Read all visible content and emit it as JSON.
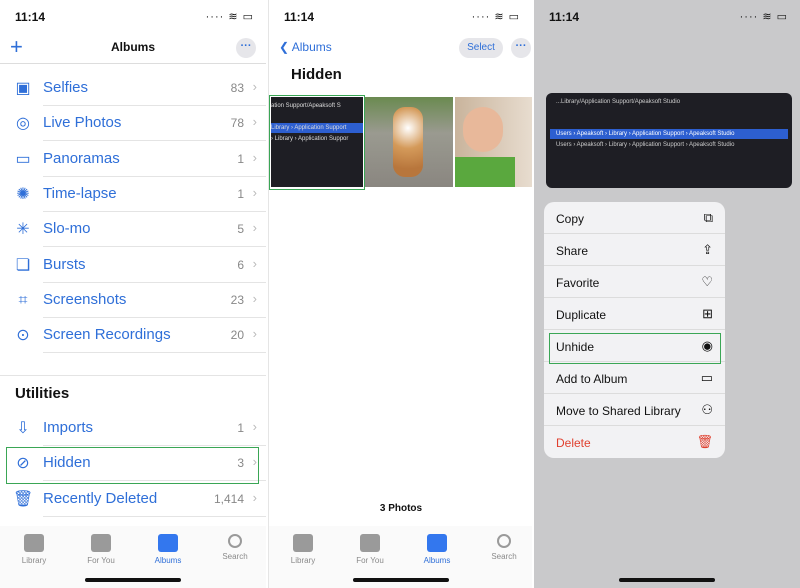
{
  "status": {
    "time": "11:14"
  },
  "albums": {
    "title": "Albums",
    "add_icon": "plus-icon",
    "media_types": [
      {
        "label": "Selfies",
        "count": "83",
        "icon": "person-square-icon"
      },
      {
        "label": "Live Photos",
        "count": "78",
        "icon": "live-photo-icon"
      },
      {
        "label": "Panoramas",
        "count": "1",
        "icon": "panorama-icon"
      },
      {
        "label": "Time-lapse",
        "count": "1",
        "icon": "timelapse-icon"
      },
      {
        "label": "Slo-mo",
        "count": "5",
        "icon": "slomo-icon"
      },
      {
        "label": "Bursts",
        "count": "6",
        "icon": "bursts-icon"
      },
      {
        "label": "Screenshots",
        "count": "23",
        "icon": "camera-viewfinder-icon"
      },
      {
        "label": "Screen Recordings",
        "count": "20",
        "icon": "record-icon"
      }
    ],
    "utilities_header": "Utilities",
    "utilities": [
      {
        "label": "Imports",
        "count": "1",
        "icon": "import-icon"
      },
      {
        "label": "Hidden",
        "count": "3",
        "icon": "eye-slash-icon"
      },
      {
        "label": "Recently Deleted",
        "count": "1,414",
        "icon": "trash-icon"
      }
    ]
  },
  "tabs": [
    {
      "label": "Library"
    },
    {
      "label": "For You"
    },
    {
      "label": "Albums",
      "active": true
    },
    {
      "label": "Search"
    }
  ],
  "hidden": {
    "back_label": "Albums",
    "select_label": "Select",
    "title": "Hidden",
    "photo_count": "3 Photos",
    "thumb_text": {
      "line1": "ation Support/Apeaksoft S",
      "line2": "Library › Application Support",
      "line3": "› Library › Application Suppor"
    }
  },
  "preview": {
    "title": "...Library/Application Support/Apeaksoft Studio",
    "line1": "Users › Apeaksoft › Library › Application Support › Apeaksoft Studio",
    "line2": "Users › Apeaksoft › Library › Application Support › Apeaksoft Studio"
  },
  "context_menu": [
    {
      "label": "Copy",
      "icon": "copy-icon",
      "glyph": "⧉"
    },
    {
      "label": "Share",
      "icon": "share-icon",
      "glyph": "⇪"
    },
    {
      "label": "Favorite",
      "icon": "heart-icon",
      "glyph": "♡"
    },
    {
      "label": "Duplicate",
      "icon": "duplicate-icon",
      "glyph": "⊞"
    },
    {
      "label": "Unhide",
      "icon": "eye-icon",
      "glyph": "◉"
    },
    {
      "label": "Add to Album",
      "icon": "add-to-album-icon",
      "glyph": "▭"
    },
    {
      "label": "Move to Shared Library",
      "icon": "people-icon",
      "glyph": "⚇"
    },
    {
      "label": "Delete",
      "icon": "trash-icon",
      "glyph": "🗑",
      "destructive": true
    }
  ],
  "colors": {
    "accent": "#2f6fd8",
    "destructive": "#e0402f",
    "highlight": "#3aa655"
  }
}
